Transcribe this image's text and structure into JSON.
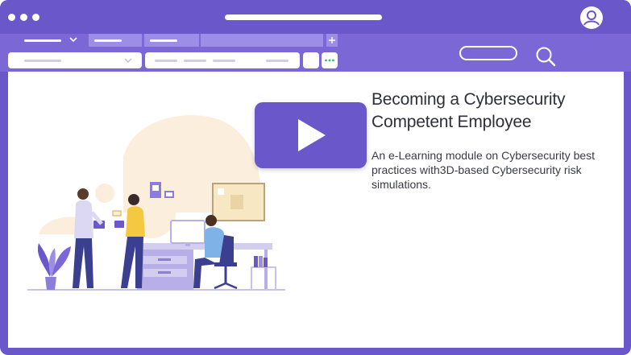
{
  "window": {
    "icons": {
      "menu": "three-dots-icon",
      "user": "user-avatar-icon",
      "search": "search-icon",
      "tab_add": "plus-icon",
      "more": "more-dots-icon"
    }
  },
  "content": {
    "title": "Becoming a Cybersecurity Competent Employee",
    "description": "An e-Learning module on Cybersecurity best practices with3D-based Cybersecurity risk simulations."
  },
  "colors": {
    "brand": "#6a57c9",
    "toolbar": "#7b68d6",
    "tab": "#9c8ee6",
    "text": "#2f2f3a"
  }
}
